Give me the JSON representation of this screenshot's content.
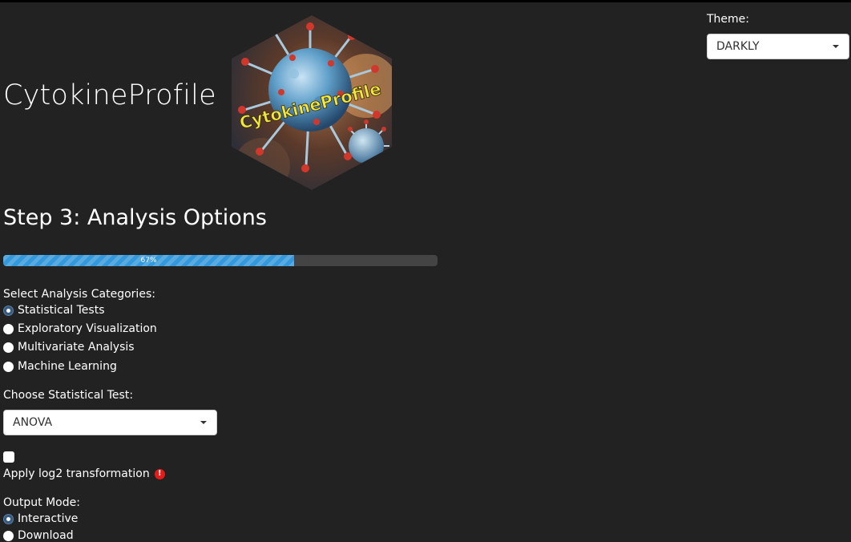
{
  "app": {
    "title": "CytokineProfile",
    "logo_text": "CytokineProfile"
  },
  "theme": {
    "label": "Theme:",
    "selected": "DARKLY"
  },
  "step": {
    "title": "Step 3: Analysis Options"
  },
  "progress": {
    "value": 0.67,
    "label": "67%"
  },
  "analysis_categories": {
    "label": "Select Analysis Categories:",
    "options": [
      {
        "label": "Statistical Tests",
        "checked": true
      },
      {
        "label": "Exploratory Visualization",
        "checked": false
      },
      {
        "label": "Multivariate Analysis",
        "checked": false
      },
      {
        "label": "Machine Learning",
        "checked": false
      }
    ]
  },
  "statistical_test": {
    "label": "Choose Statistical Test:",
    "selected": "ANOVA"
  },
  "log2": {
    "checked": false,
    "label": "Apply log2 transformation",
    "icon": "warning-icon"
  },
  "output_mode": {
    "label": "Output Mode:",
    "options": [
      {
        "label": "Interactive",
        "checked": true
      },
      {
        "label": "Download",
        "checked": false
      }
    ]
  },
  "colors": {
    "background": "#222222",
    "accent": "#375a7f",
    "progress": "#3498db",
    "warning": "#e31b1b"
  }
}
